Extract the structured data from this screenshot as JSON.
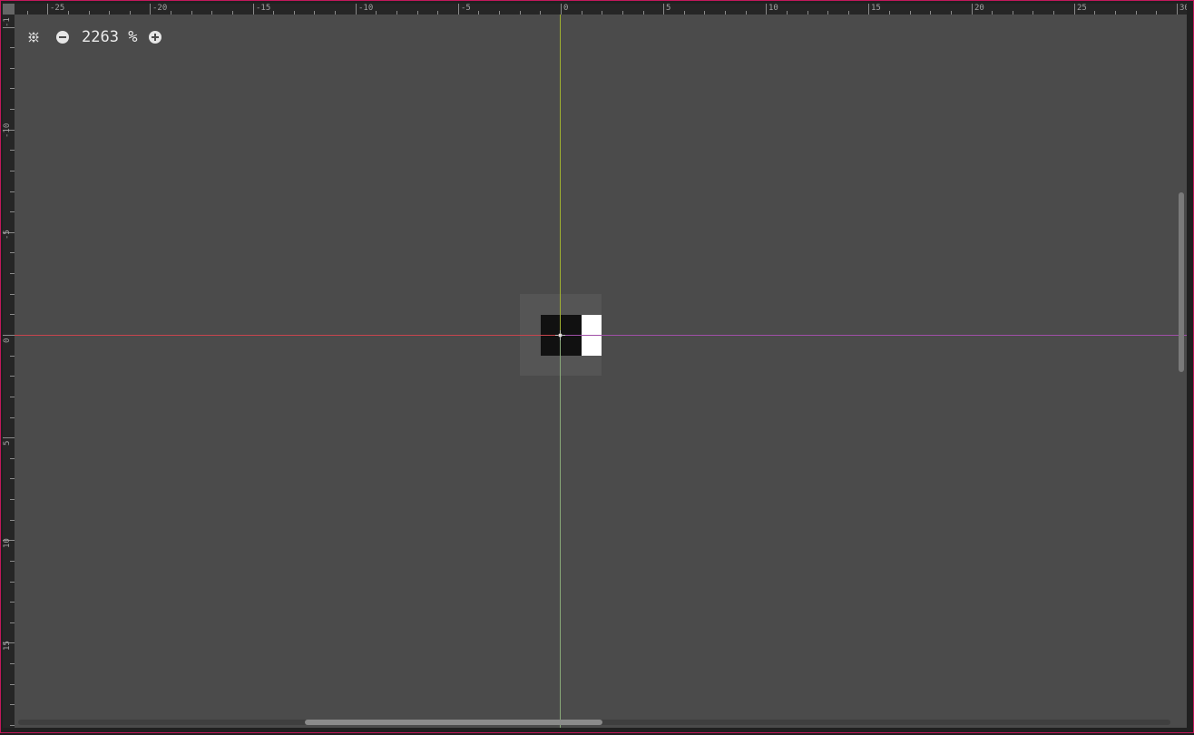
{
  "toolbar": {
    "zoom_value": "2263",
    "zoom_unit": "%",
    "center_icon": "center-view-icon",
    "zoom_out_icon": "zoom-out-icon",
    "zoom_in_icon": "zoom-in-icon"
  },
  "rulers": {
    "horizontal_labels": [
      "-25",
      "-20",
      "-15",
      "-10",
      "-5",
      "0",
      "5",
      "10",
      "15",
      "20",
      "25",
      "30"
    ],
    "vertical_labels": [
      "-1",
      "-10",
      "-5",
      "0",
      "5",
      "10",
      "15"
    ]
  },
  "colors": {
    "frame_border": "#c2185b",
    "canvas_bg": "#4b4b4b",
    "axis_x_negative": "#c8454e",
    "axis_x_positive": "#a050a8",
    "axis_y_negative": "#a0b030",
    "axis_y_positive": "#88a878"
  }
}
